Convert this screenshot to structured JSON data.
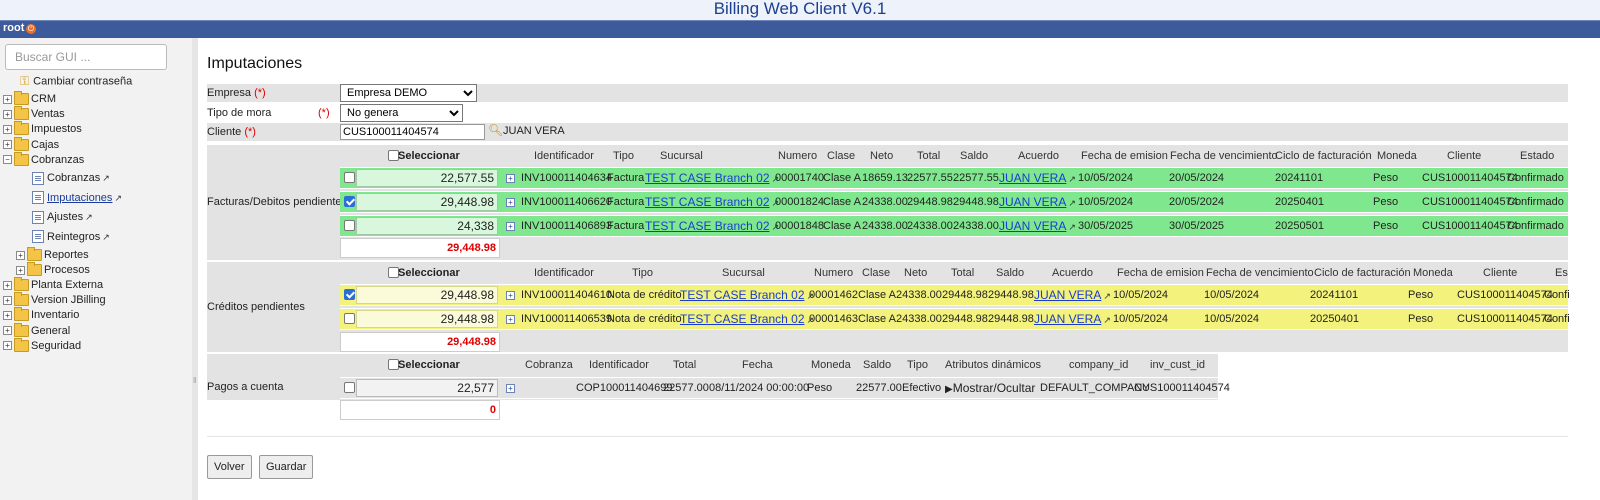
{
  "app": {
    "title": "Billing Web Client V6.1",
    "user": "root"
  },
  "sidebar": {
    "search_placeholder": "Buscar GUI ...",
    "change_password": "Cambiar contraseña",
    "items": [
      "CRM",
      "Ventas",
      "Impuestos",
      "Cajas",
      "Cobranzas"
    ],
    "cobranzas_children": [
      "Cobranzas",
      "Imputaciones",
      "Ajustes",
      "Reintegros"
    ],
    "sub_folders": [
      "Reportes",
      "Procesos"
    ],
    "items_after": [
      "Planta Externa",
      "Version JBilling",
      "Inventario",
      "General",
      "Seguridad"
    ]
  },
  "form": {
    "title": "Imputaciones",
    "empresa_label": "Empresa",
    "empresa_value": "Empresa DEMO",
    "mora_label": "Tipo de mora",
    "mora_value": "No genera",
    "cliente_label": "Cliente",
    "cliente_value": "CUS100011404574",
    "cliente_name": "JUAN VERA",
    "required_mark": "(*)"
  },
  "facturas": {
    "label": "Facturas/Debitos pendientes",
    "select_label": "Seleccionar",
    "headers": [
      "Identificador",
      "Tipo",
      "Sucursal",
      "Numero",
      "Clase",
      "Neto",
      "Total",
      "Saldo",
      "Acuerdo",
      "Fecha de emision",
      "Fecha de vencimiento",
      "Ciclo de facturación",
      "Moneda",
      "Cliente",
      "Estado"
    ],
    "rows": [
      {
        "checked": false,
        "amount": "22,577.55",
        "id": "INV100011404634",
        "tipo": "Factura",
        "sucursal": "TEST CASE Branch 02",
        "numero": "00001740",
        "clase": "Clase A",
        "neto": "18659.13",
        "total": "22577.55",
        "saldo": "22577.55",
        "acuerdo": "JUAN VERA",
        "emision": "10/05/2024",
        "vencimiento": "20/05/2024",
        "ciclo": "20241101",
        "moneda": "Peso",
        "cliente": "CUS100011404574",
        "estado": "Confirmado"
      },
      {
        "checked": true,
        "amount": "29,448.98",
        "id": "INV100011406620",
        "tipo": "Factura",
        "sucursal": "TEST CASE Branch 02",
        "numero": "00001824",
        "clase": "Clase A",
        "neto": "24338.00",
        "total": "29448.98",
        "saldo": "29448.98",
        "acuerdo": "JUAN VERA",
        "emision": "10/05/2024",
        "vencimiento": "20/05/2024",
        "ciclo": "20250401",
        "moneda": "Peso",
        "cliente": "CUS100011404574",
        "estado": "Confirmado"
      },
      {
        "checked": false,
        "amount": "24,338",
        "id": "INV100011406893",
        "tipo": "Factura",
        "sucursal": "TEST CASE Branch 02",
        "numero": "00001848",
        "clase": "Clase A",
        "neto": "24338.00",
        "total": "24338.00",
        "saldo": "24338.00",
        "acuerdo": "JUAN VERA",
        "emision": "30/05/2025",
        "vencimiento": "30/05/2025",
        "ciclo": "20250501",
        "moneda": "Peso",
        "cliente": "CUS100011404574",
        "estado": "Confirmado"
      }
    ],
    "total": "29,448.98"
  },
  "creditos": {
    "label": "Créditos pendientes",
    "select_label": "Seleccionar",
    "headers": [
      "Identificador",
      "Tipo",
      "Sucursal",
      "Numero",
      "Clase",
      "Neto",
      "Total",
      "Saldo",
      "Acuerdo",
      "Fecha de emision",
      "Fecha de vencimiento",
      "Ciclo de facturación",
      "Moneda",
      "Cliente",
      "Es"
    ],
    "rows": [
      {
        "checked": true,
        "amount": "29,448.98",
        "id": "INV100011404610",
        "tipo": "Nota de crédito",
        "sucursal": "TEST CASE Branch 02",
        "numero": "00001462",
        "clase": "Clase A",
        "neto": "24338.00",
        "total": "29448.98",
        "saldo": "29448.98",
        "acuerdo": "JUAN VERA",
        "emision": "10/05/2024",
        "vencimiento": "10/05/2024",
        "ciclo": "20241101",
        "moneda": "Peso",
        "cliente": "CUS100011404574",
        "estado": "Confi"
      },
      {
        "checked": false,
        "amount": "29,448.98",
        "id": "INV100011406539",
        "tipo": "Nota de crédito",
        "sucursal": "TEST CASE Branch 02",
        "numero": "00001463",
        "clase": "Clase A",
        "neto": "24338.00",
        "total": "29448.98",
        "saldo": "29448.98",
        "acuerdo": "JUAN VERA",
        "emision": "10/05/2024",
        "vencimiento": "10/05/2024",
        "ciclo": "20250401",
        "moneda": "Peso",
        "cliente": "CUS100011404574",
        "estado": "Confi"
      }
    ],
    "total": "29,448.98"
  },
  "pagos": {
    "label": "Pagos a cuenta",
    "select_label": "Seleccionar",
    "headers": [
      "Cobranza",
      "Identificador",
      "Total",
      "Fecha",
      "Moneda",
      "Saldo",
      "Tipo",
      "Atributos dinámicos",
      "company_id",
      "inv_cust_id"
    ],
    "row": {
      "checked": false,
      "amount": "22,577",
      "id": "COP100011404699",
      "total": "22577.00",
      "fecha": "08/11/2024 00:00:00",
      "moneda": "Peso",
      "saldo": "22577.00",
      "tipo": "Efectivo",
      "atributos": "Mostrar/Ocultar",
      "company": "DEFAULT_COMPANY",
      "cust": "CUS100011404574"
    },
    "total": "0"
  },
  "buttons": {
    "back": "Volver",
    "save": "Guardar"
  }
}
